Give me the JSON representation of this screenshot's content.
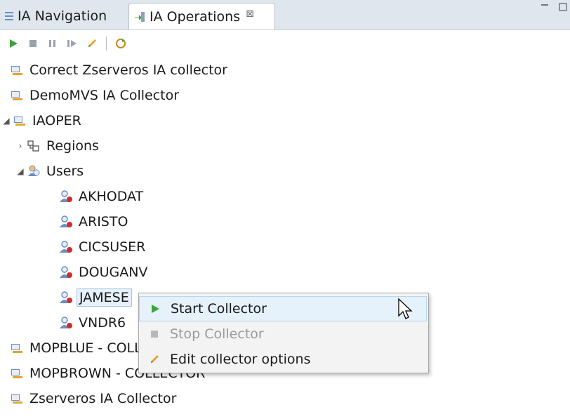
{
  "tabs": [
    {
      "label": "IA Navigation",
      "icon": "navigation-icon",
      "active": false
    },
    {
      "label": "IA Operations",
      "icon": "operations-icon",
      "active": true
    }
  ],
  "tab_close_glyph": "⊠",
  "toolbar": {
    "icons": [
      "start-icon",
      "stop-icon",
      "pause-icon",
      "resume-icon",
      "edit-icon",
      "refresh-icon"
    ]
  },
  "tree": [
    {
      "label": "Correct Zserveros IA collector",
      "icon": "collector-icon"
    },
    {
      "label": "DemoMVS IA Collector",
      "icon": "collector-icon"
    },
    {
      "label": "IAOPER",
      "icon": "collector-icon",
      "expanded": true
    },
    {
      "label": "Regions",
      "icon": "regions-icon",
      "expanded": false
    },
    {
      "label": "Users",
      "icon": "users-icon",
      "expanded": true
    },
    {
      "label": "AKHODAT",
      "icon": "user-icon"
    },
    {
      "label": "ARISTO",
      "icon": "user-icon"
    },
    {
      "label": "CICSUSER",
      "icon": "user-icon"
    },
    {
      "label": "DOUGANV",
      "icon": "user-icon"
    },
    {
      "label": "JAMESE",
      "icon": "user-icon",
      "selected": true
    },
    {
      "label": "VNDR6",
      "icon": "user-icon"
    },
    {
      "label": "MOPBLUE  - COLLECTOR",
      "icon": "collector-icon"
    },
    {
      "label": "MOPBROWN - COLLECTOR",
      "icon": "collector-icon"
    },
    {
      "label": "Zserveros IA Collector",
      "icon": "collector-icon"
    }
  ],
  "context_menu": [
    {
      "label": "Start Collector",
      "icon": "start-icon",
      "enabled": true,
      "hover": true
    },
    {
      "label": "Stop Collector",
      "icon": "stop-icon",
      "enabled": false
    },
    {
      "label": "Edit collector options",
      "icon": "edit-icon",
      "enabled": true
    }
  ],
  "colors": {
    "accent_green": "#3aa63a",
    "user_red": "#d22b2b",
    "user_blue": "#6a8fc7"
  }
}
